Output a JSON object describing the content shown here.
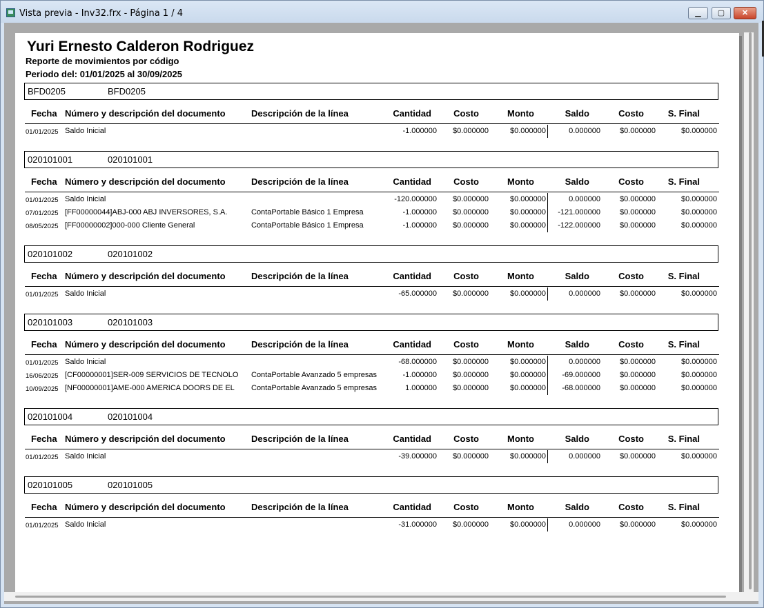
{
  "window": {
    "title": "Vista previa - Inv32.frx - Página 1 / 4"
  },
  "report": {
    "title": "Yuri Ernesto Calderon Rodriguez",
    "subtitle": "Reporte de movimientos por código",
    "period": "Periodo del: 01/01/2025 al 30/09/2025"
  },
  "headers": {
    "fecha": "Fecha",
    "numero": "Número y descripción del documento",
    "descripcion": "Descripción de la línea",
    "cantidad": "Cantidad",
    "costo": "Costo",
    "monto": "Monto",
    "saldo": "Saldo",
    "costo2": "Costo",
    "sfinal": "S. Final"
  },
  "sections": [
    {
      "code": "BFD0205",
      "name": "BFD0205",
      "rows": [
        {
          "fecha": "01/01/2025",
          "doc": "Saldo Inicial",
          "desc": "",
          "cantidad": "-1.000000",
          "costo": "$0.000000",
          "monto": "$0.000000",
          "saldo": "0.000000",
          "costo2": "$0.000000",
          "sfinal": "$0.000000"
        }
      ]
    },
    {
      "code": "020101001",
      "name": "020101001",
      "rows": [
        {
          "fecha": "01/01/2025",
          "doc": "Saldo Inicial",
          "desc": "",
          "cantidad": "-120.000000",
          "costo": "$0.000000",
          "monto": "$0.000000",
          "saldo": "0.000000",
          "costo2": "$0.000000",
          "sfinal": "$0.000000"
        },
        {
          "fecha": "07/01/2025",
          "doc": "[FF00000044]ABJ-000 ABJ INVERSORES, S.A.",
          "desc": "ContaPortable Básico 1 Empresa",
          "cantidad": "-1.000000",
          "costo": "$0.000000",
          "monto": "$0.000000",
          "saldo": "-121.000000",
          "costo2": "$0.000000",
          "sfinal": "$0.000000"
        },
        {
          "fecha": "08/05/2025",
          "doc": "[FF00000002]000-000 Cliente General",
          "desc": "ContaPortable Básico 1 Empresa",
          "cantidad": "-1.000000",
          "costo": "$0.000000",
          "monto": "$0.000000",
          "saldo": "-122.000000",
          "costo2": "$0.000000",
          "sfinal": "$0.000000"
        }
      ]
    },
    {
      "code": "020101002",
      "name": "020101002",
      "rows": [
        {
          "fecha": "01/01/2025",
          "doc": "Saldo Inicial",
          "desc": "",
          "cantidad": "-65.000000",
          "costo": "$0.000000",
          "monto": "$0.000000",
          "saldo": "0.000000",
          "costo2": "$0.000000",
          "sfinal": "$0.000000"
        }
      ]
    },
    {
      "code": "020101003",
      "name": "020101003",
      "rows": [
        {
          "fecha": "01/01/2025",
          "doc": "Saldo Inicial",
          "desc": "",
          "cantidad": "-68.000000",
          "costo": "$0.000000",
          "monto": "$0.000000",
          "saldo": "0.000000",
          "costo2": "$0.000000",
          "sfinal": "$0.000000"
        },
        {
          "fecha": "16/06/2025",
          "doc": "[CF00000001]SER-009 SERVICIOS DE TECNOLO",
          "desc": "ContaPortable Avanzado 5 empresas",
          "cantidad": "-1.000000",
          "costo": "$0.000000",
          "monto": "$0.000000",
          "saldo": "-69.000000",
          "costo2": "$0.000000",
          "sfinal": "$0.000000"
        },
        {
          "fecha": "10/09/2025",
          "doc": "[NF00000001]AME-000 AMERICA DOORS DE EL",
          "desc": "ContaPortable Avanzado 5 empresas",
          "cantidad": "1.000000",
          "costo": "$0.000000",
          "monto": "$0.000000",
          "saldo": "-68.000000",
          "costo2": "$0.000000",
          "sfinal": "$0.000000"
        }
      ]
    },
    {
      "code": "020101004",
      "name": "020101004",
      "rows": [
        {
          "fecha": "01/01/2025",
          "doc": "Saldo Inicial",
          "desc": "",
          "cantidad": "-39.000000",
          "costo": "$0.000000",
          "monto": "$0.000000",
          "saldo": "0.000000",
          "costo2": "$0.000000",
          "sfinal": "$0.000000"
        }
      ]
    },
    {
      "code": "020101005",
      "name": "020101005",
      "rows": [
        {
          "fecha": "01/01/2025",
          "doc": "Saldo Inicial",
          "desc": "",
          "cantidad": "-31.000000",
          "costo": "$0.000000",
          "monto": "$0.000000",
          "saldo": "0.000000",
          "costo2": "$0.000000",
          "sfinal": "$0.000000"
        }
      ]
    }
  ]
}
